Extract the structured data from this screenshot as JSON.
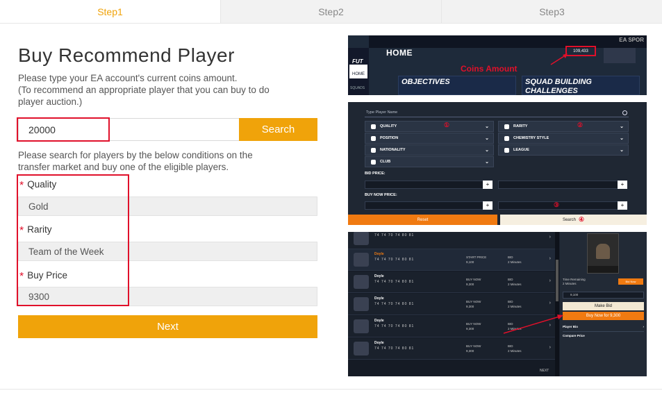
{
  "steps": [
    {
      "label": "Step1",
      "active": true
    },
    {
      "label": "Step2",
      "active": false
    },
    {
      "label": "Step3",
      "active": false
    }
  ],
  "form": {
    "title": "Buy Recommend Player",
    "instructions": [
      "Please type your EA account's current coins amount.",
      "(To recommend an appropriate player that you can buy to do",
      "player auction.)"
    ],
    "coins_value": "20000",
    "search_label": "Search",
    "conditions_text": [
      "Please search for players by the below conditions on the",
      "transfer market and buy one of the eligible players."
    ],
    "fields": [
      {
        "label": "Quality",
        "value": "Gold"
      },
      {
        "label": "Rarity",
        "value": "Team of the Week"
      },
      {
        "label": "Buy Price",
        "value": "9300"
      }
    ],
    "required_mark": "*",
    "next_label": "Next"
  },
  "guide": {
    "home_screen": {
      "brand": "FUT",
      "ea": "EA SPOR",
      "title": "HOME",
      "nav_home": "HOME",
      "nav_squads": "SQUADS",
      "coins_display": "109,433",
      "coins_label": "Coins Amount",
      "tile_objectives": "OBJECTIVES",
      "tile_sbc_line1": "SQUAD BUILDING",
      "tile_sbc_line2": "CHALLENGES"
    },
    "market_screen": {
      "search_placeholder": "Type Player Name",
      "filters": [
        "QUALITY",
        "RARITY",
        "POSITION",
        "CHEMISTRY STYLE",
        "NATIONALITY",
        "LEAGUE",
        "CLUB"
      ],
      "markers": [
        "①",
        "②",
        "③",
        "④"
      ],
      "bid_price": "BID PRICE:",
      "buy_now_price": "BUY NOW PRICE:",
      "reset": "Reset",
      "search": "Search"
    },
    "results_screen": {
      "player_name": "Doyle",
      "stats": "74 74 70 74 80 81",
      "price_line1": "START PRICE",
      "price_line2": "9,100",
      "price_line3": "BUY NOW",
      "price_line4": "9,300",
      "time_line1": "BID",
      "time_line2": "2 Minutes",
      "next": "NEXT",
      "info_line1": "Time Remaining",
      "info_line2": "2 Minutes",
      "bid_field_value": "9,100",
      "bid_button": "Bid Now",
      "make_bid": "Make Bid",
      "buy_now": "Buy Now for 9,300",
      "player_bio": "Player Bio",
      "compare_price": "Compare Price"
    }
  },
  "colors": {
    "accent": "#f0a30a",
    "highlight_red": "#e0102a",
    "fut_orange": "#f07a11"
  }
}
